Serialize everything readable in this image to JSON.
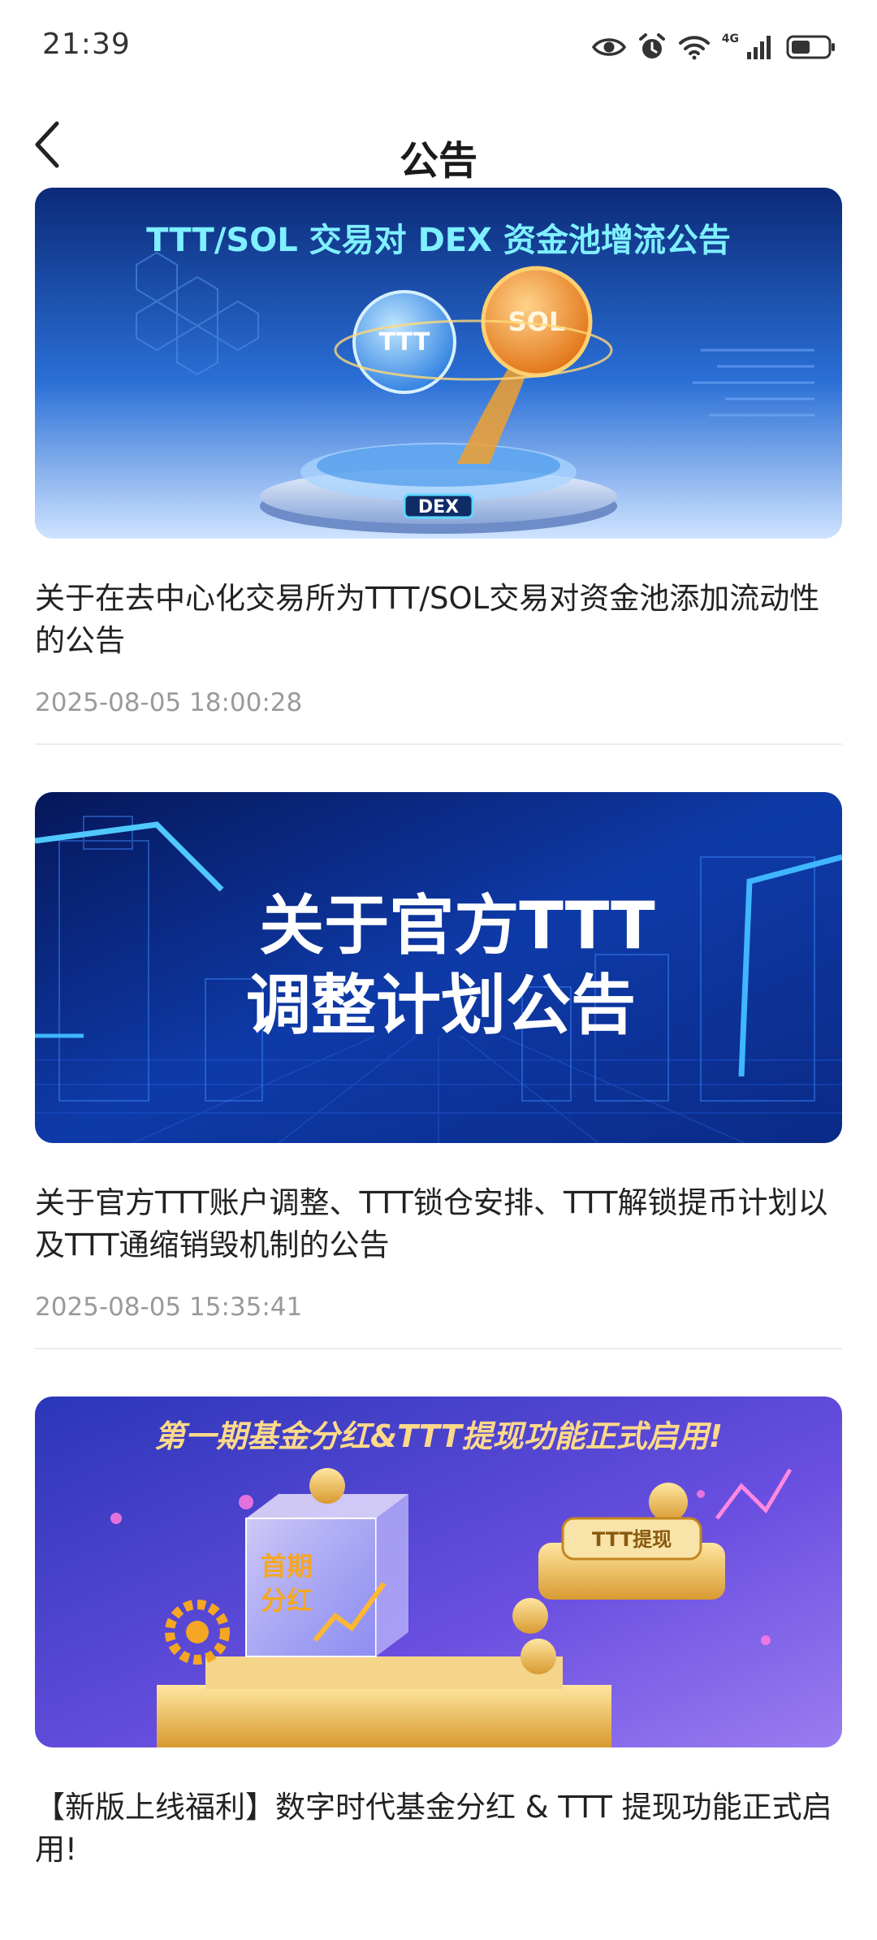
{
  "status_bar": {
    "time": "21:39",
    "network": "4G",
    "icons": [
      "eye-icon",
      "alarm-icon",
      "wifi-icon",
      "signal-icon",
      "battery-icon"
    ]
  },
  "header": {
    "back_icon": "chevron-left-icon",
    "title": "公告"
  },
  "announcements": [
    {
      "banner_heading": "TTT/SOL 交易对 DEX 资金池增流公告",
      "banner_labels": [
        "TTT",
        "SOL",
        "DEX"
      ],
      "title": "关于在去中心化交易所为TTT/SOL交易对资金池添加流动性的公告",
      "date": "2025-08-05 18:00:28"
    },
    {
      "banner_heading_line1": "关于官方TTT",
      "banner_heading_line2": "调整计划公告",
      "title": "关于官方TTT账户调整、TTT锁仓安排、TTT解锁提币计划以及TTT通缩销毁机制的公告",
      "date": "2025-08-05 15:35:41"
    },
    {
      "banner_heading": "第一期基金分红&TTT提现功能正式启用!",
      "banner_labels": [
        "首期",
        "分红",
        "TTT提现"
      ],
      "title": "【新版上线福利】数字时代基金分红 & TTT 提现功能正式启用!"
    }
  ],
  "colors": {
    "background": "#ffffff",
    "title_text": "#222222",
    "date_text": "#9a9a9a",
    "divider": "#ececec"
  }
}
